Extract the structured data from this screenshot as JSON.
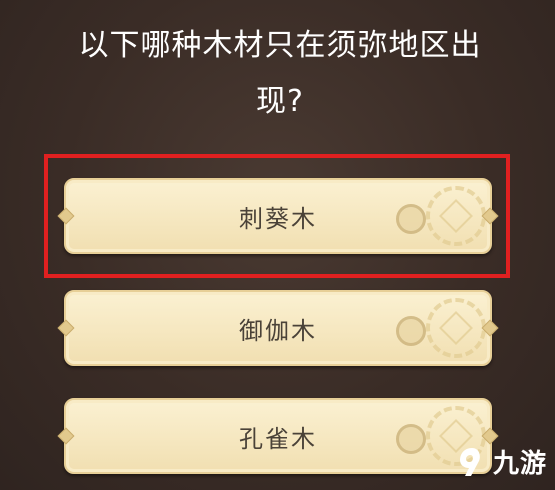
{
  "question": {
    "line1": "以下哪种木材只在须弥地区出",
    "line2": "现?"
  },
  "options": [
    {
      "label": "刺葵木",
      "highlighted": true
    },
    {
      "label": "御伽木",
      "highlighted": false
    },
    {
      "label": "孔雀木",
      "highlighted": false
    }
  ],
  "highlight_color": "#e02020",
  "watermark": {
    "text": "九游",
    "icon": "jiuyou-logo-icon"
  }
}
